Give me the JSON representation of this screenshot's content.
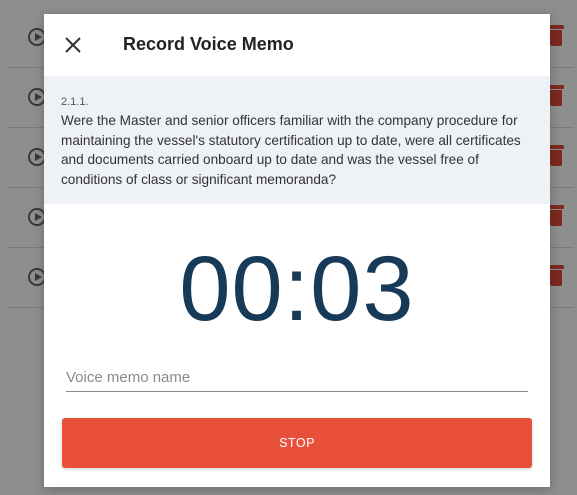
{
  "modal": {
    "title": "Record Voice Memo",
    "question_number": "2.1.1.",
    "question_text": "Were the Master and senior officers familiar with the company procedure for maintaining the vessel's statutory certification up to date, were all certificates and documents carried onboard up to date and was the vessel free of conditions of class or significant memoranda?",
    "timer": "00:03",
    "name_placeholder": "Voice memo name",
    "name_value": "",
    "stop_label": "STOP"
  },
  "colors": {
    "accent": "#e8503a",
    "timer": "#163a57",
    "question_bg": "#eef1f5"
  }
}
